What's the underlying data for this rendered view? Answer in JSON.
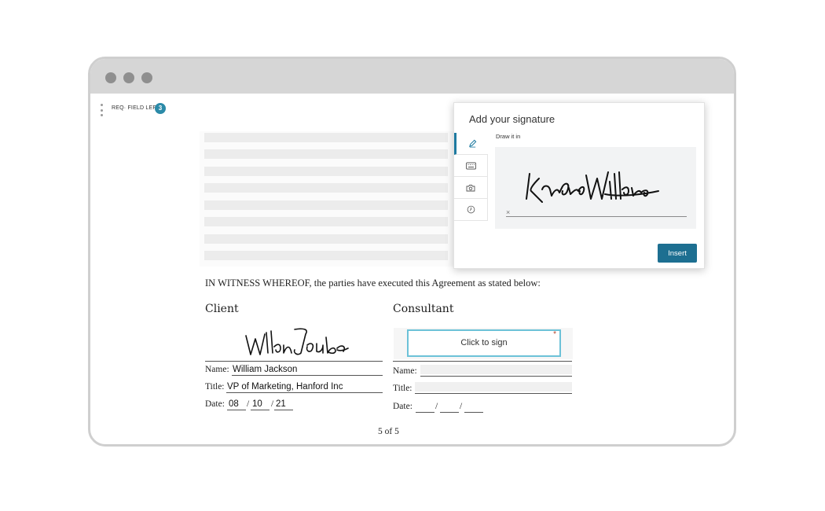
{
  "toolbar": {
    "req_label": "REQ· FIELD LEFT",
    "req_count": "3"
  },
  "document": {
    "witness_text": "IN WITNESS WHEREOF, the parties have executed this Agreement as stated below:",
    "client": {
      "heading": "Client",
      "signature_text": "William Jackson",
      "name_label": "Name:",
      "name_value": "William Jackson",
      "title_label": "Title:",
      "title_value": "VP of Marketing, Hanford Inc",
      "date_label": "Date:",
      "date_month": "08",
      "date_day": "10",
      "date_year": "21",
      "date_sep": "/"
    },
    "consultant": {
      "heading": "Consultant",
      "click_to_sign": "Click to sign",
      "required_mark": "*",
      "name_label": "Name:",
      "title_label": "Title:",
      "date_label": "Date:",
      "date_sep": "/"
    },
    "page_count": "5 of 5"
  },
  "signature_panel": {
    "title": "Add your signature",
    "tabs": [
      {
        "icon": "pencil-icon",
        "active": true
      },
      {
        "icon": "keyboard-icon",
        "active": false
      },
      {
        "icon": "camera-icon",
        "active": false
      },
      {
        "icon": "clock-icon",
        "active": false
      }
    ],
    "draw_label": "Draw it in",
    "drawn_signature_text": "Kimberly Williams",
    "clear_symbol": "×",
    "insert_label": "Insert"
  },
  "colors": {
    "accent": "#1d6f91",
    "badge": "#2b8aa8",
    "sign_box_border": "#6cc2d8",
    "required_star": "#b5442b"
  }
}
